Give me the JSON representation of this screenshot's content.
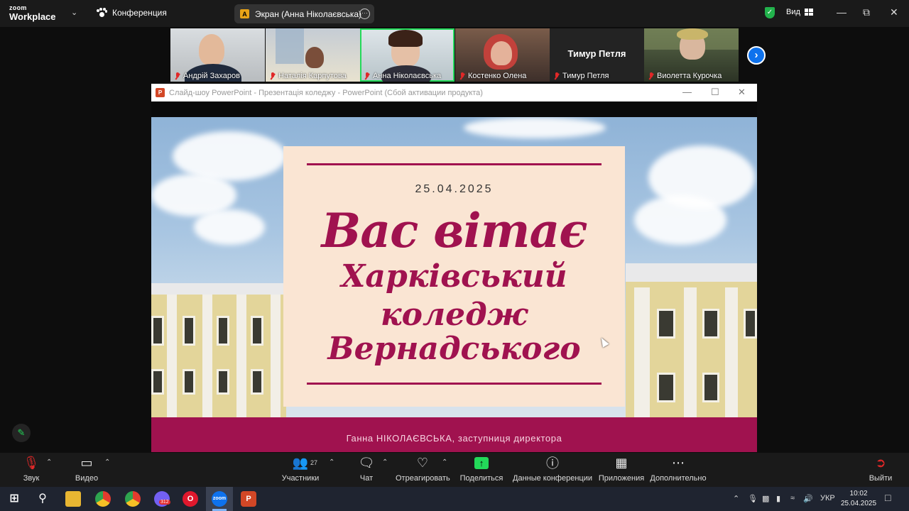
{
  "app": {
    "brand_top": "zoom",
    "brand_bottom": "Workplace",
    "meeting_label": "Конференция",
    "share_badge": "A",
    "share_label": "Экран (Анна Ніколаєвська)",
    "view_label": "Вид"
  },
  "participants": [
    {
      "name": "Андрій Захаров",
      "muted": true
    },
    {
      "name": "Наталія Карпутова",
      "muted": true
    },
    {
      "name": "Анна Ніколаєвська",
      "muted": true,
      "active": true
    },
    {
      "name": "Костенко Олена",
      "muted": true
    },
    {
      "name": "Тимур  Петля",
      "muted": true,
      "nameplate": "Тимур  Петля"
    },
    {
      "name": "Виолетта Курочка",
      "muted": true
    }
  ],
  "ppt": {
    "logo": "P",
    "window_title": "Слайд-шоу PowerPoint  -  Презентація коледжу - PowerPoint (Сбой активации продукта)"
  },
  "slide": {
    "date": "25.04.2025",
    "line1": "Вас вітає",
    "line2": "Харківський",
    "line3": "коледж",
    "line4": "Вернадського",
    "footer": "Ганна НІКОЛАЄВСЬКА, заступниця директора",
    "accent_color": "#a0124f",
    "card_color": "#fae5d3"
  },
  "toolbar": {
    "audio": "Звук",
    "video": "Видео",
    "participants": "Участники",
    "participants_count": "27",
    "chat": "Чат",
    "react": "Отреагировать",
    "share": "Поделиться",
    "info": "Данные конференции",
    "apps": "Приложения",
    "more": "Дополнительно",
    "leave": "Выйти"
  },
  "taskbar": {
    "viber_badge": "312",
    "zoom_label": "zoom",
    "lang": "УКР",
    "time": "10:02",
    "date": "25.04.2025"
  },
  "icons": {
    "shield": "shield-check-icon",
    "accent_green": "#23d959",
    "zoom_blue": "#0e72ed"
  }
}
